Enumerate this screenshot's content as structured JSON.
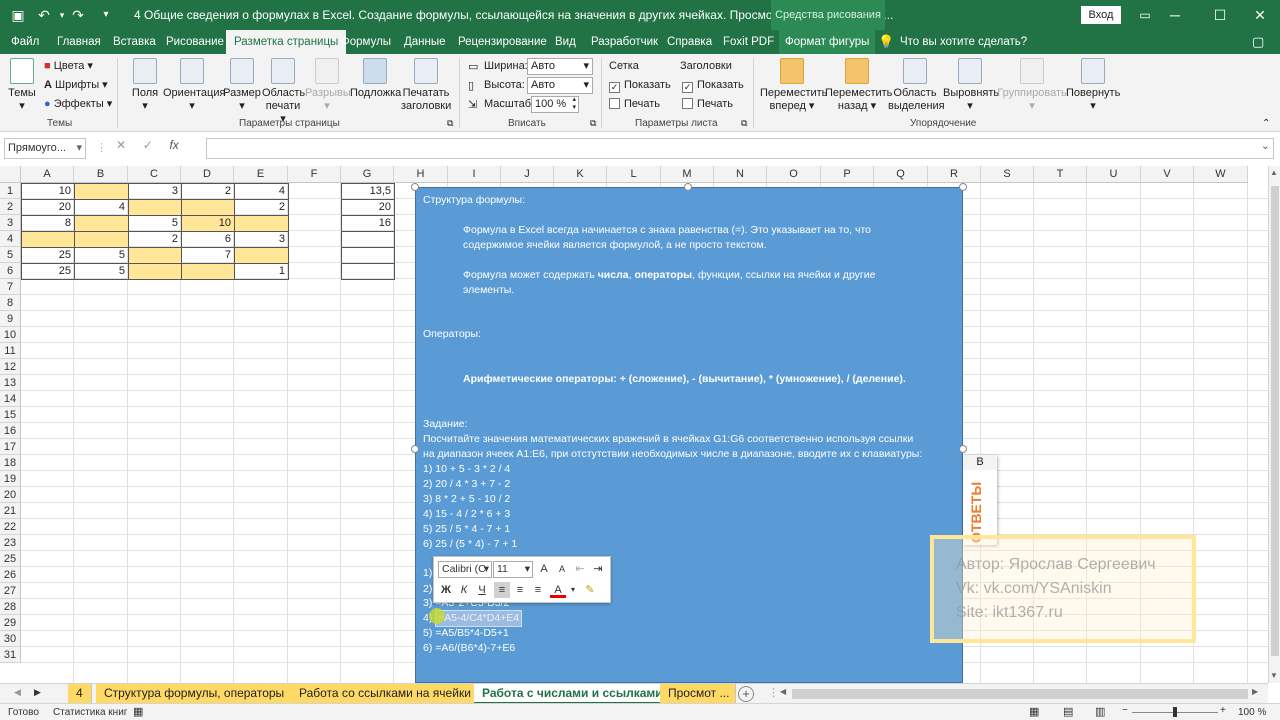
{
  "titlebar": {
    "title": "4 Общие сведения о формулах в Excel. Создание формулы, ссылающейся на значения в других ячейках. Просмотр формулы.xlsx  -  E...",
    "context_tab": "Средства рисования",
    "login": "Вход",
    "icons": [
      "save-icon",
      "undo-icon",
      "redo-icon",
      "customize-icon",
      "ribbon-display-icon",
      "minimize-icon",
      "maximize-icon",
      "close-icon"
    ]
  },
  "tabs": [
    "Файл",
    "Главная",
    "Вставка",
    "Рисование",
    "Разметка страницы",
    "Формулы",
    "Данные",
    "Рецензирование",
    "Вид",
    "Разработчик",
    "Справка",
    "Foxit PDF",
    "Формат фигуры",
    "Что вы хотите сделать?"
  ],
  "ribbon": {
    "themes": {
      "button": "Темы",
      "colors": "Цвета",
      "fonts": "Шрифты",
      "effects": "Эффекты",
      "group": "Темы"
    },
    "page": {
      "fields": "Поля",
      "orientation": "Ориентация",
      "size": "Размер",
      "print_area_1": "Область",
      "print_area_2": "печати",
      "breaks": "Разрывы",
      "background": "Подложка",
      "titles_1": "Печатать",
      "titles_2": "заголовки",
      "group": "Параметры страницы"
    },
    "fit": {
      "width_label": "Ширина:",
      "width_value": "Авто",
      "height_label": "Высота:",
      "height_value": "Авто",
      "scale_label": "Масштаб:",
      "scale_value": "100 %",
      "group": "Вписать"
    },
    "sheet": {
      "grid": "Сетка",
      "headings": "Заголовки",
      "show1": "Показать",
      "print1": "Печать",
      "show2": "Показать",
      "print2": "Печать",
      "group": "Параметры листа"
    },
    "arrange": {
      "forward_1": "Переместить",
      "forward_2": "вперед",
      "backward_1": "Переместить",
      "backward_2": "назад",
      "selection_1": "Область",
      "selection_2": "выделения",
      "align": "Выровнять",
      "group_btn": "Группировать",
      "rotate": "Повернуть",
      "group": "Упорядочение"
    }
  },
  "formula_bar": {
    "namebox": "Прямоуго..."
  },
  "columns": [
    "A",
    "B",
    "C",
    "D",
    "E",
    "F",
    "G",
    "H",
    "I",
    "J",
    "K",
    "L",
    "M",
    "N",
    "O",
    "P",
    "Q",
    "R",
    "S",
    "T",
    "U",
    "V",
    "W"
  ],
  "rows": [
    "1",
    "2",
    "3",
    "4",
    "5",
    "6",
    "7",
    "8",
    "9",
    "10",
    "11",
    "12",
    "13",
    "14",
    "15",
    "16",
    "17",
    "18",
    "19",
    "20",
    "21",
    "22",
    "23",
    "25",
    "26",
    "27",
    "28",
    "29",
    "30",
    "31"
  ],
  "cells": {
    "A1": "10",
    "C1": "3",
    "D1": "2",
    "E1": "4",
    "G1": "13,5",
    "A2": "20",
    "B2": "4",
    "E2": "2",
    "G2": "20",
    "A3": "8",
    "C3": "5",
    "D3": "10",
    "G3": "16",
    "C4": "2",
    "D4": "6",
    "E4": "3",
    "A5": "25",
    "B5": "5",
    "D5": "7",
    "A6": "25",
    "B6": "5",
    "E6": "1"
  },
  "shape": {
    "h1": "Структура формулы:",
    "p1a": "Формула в Excel всегда начинается с знака равенства (=). Это указывает на то, что",
    "p1b": "содержимое ячейки является формулой, а не просто текстом.",
    "p2a_pre": "Формула может содержать ",
    "p2a_b1": "числа",
    "p2a_sep": ", ",
    "p2a_b2": "операторы",
    "p2a_post": ", функции, ссылки на ячейки и другие",
    "p2b": "элементы.",
    "h2": "Операторы:",
    "ops": "Арифметические операторы: + (сложение), - (вычитание), * (умножение), / (деление).",
    "h3": "Задание:",
    "t1": "Посчитайте значения математических вражений в ячейках G1:G6 соответственно используя ссылки",
    "t2": "на диапазон ячеек A1:E6, при отстутствии необходимых числе в диапазоне, вводите их с клавиатуры:",
    "e1": "1) 10 + 5 - 3 * 2 / 4",
    "e2": "2) 20 / 4 * 3 + 7 - 2",
    "e3": "3) 8 * 2 + 5 - 10 / 2",
    "e4": "4) 15 - 4 / 2 * 6 + 3",
    "e5": "5) 25 / 5 * 4 - 7 + 1",
    "e6": "6) 25 / (5 * 4) - 7 + 1",
    "f1": "1)",
    "f2": "2)",
    "f3": "3) =A3*2+C3-D3/2",
    "f4": "=A5-4/C4*D4+E4",
    "f4n": "4)",
    "f5": "5) =A5/B5*4-D5+1",
    "f6": "6) =A6/(B6*4)-7+E6"
  },
  "mini_toolbar": {
    "font": "Calibri (С",
    "size": "11",
    "bold": "Ж",
    "italic": "К",
    "underline": "Ч",
    "grow": "A",
    "shrink": "A"
  },
  "otvety": {
    "col": "B",
    "text": "ОТВЕТЫ"
  },
  "watermark": {
    "l1": "Автор: Ярослав Сергеевич",
    "l2": "Vk: vk.com/YSAniskin",
    "l3": "Site: ikt1367.ru"
  },
  "sheet_tabs": [
    "4",
    "Структура формулы, операторы",
    "Работа со ссылками на ячейки",
    "Работа с числами и ссылками",
    "Просмот ..."
  ],
  "status": {
    "ready": "Готово",
    "stats": "Статистика книг",
    "zoom": "100 %"
  },
  "colors": {
    "excel_green": "#217346",
    "shape_blue": "#5b9bd5",
    "yellow": "#ffe699"
  }
}
